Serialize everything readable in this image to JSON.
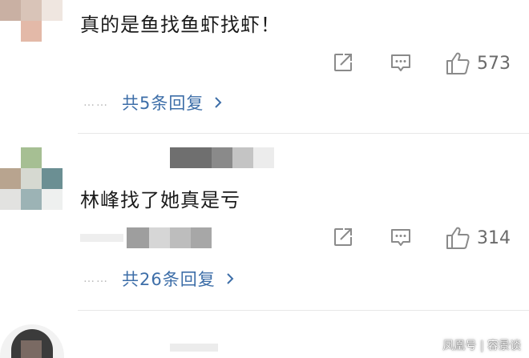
{
  "comments": [
    {
      "text": "真的是鱼找鱼虾找虾！",
      "like_count": "573",
      "replies_label": "共5条回复"
    },
    {
      "text": "林峰找了她真是亏",
      "like_count": "314",
      "replies_label": "共26条回复"
    }
  ],
  "replies_dots": "……",
  "watermark": "凤凰号 | 容景谈",
  "colors": {
    "link_blue": "#3d6ea8",
    "icon_gray": "#8a8a8a",
    "divider": "#e8e8e8"
  }
}
